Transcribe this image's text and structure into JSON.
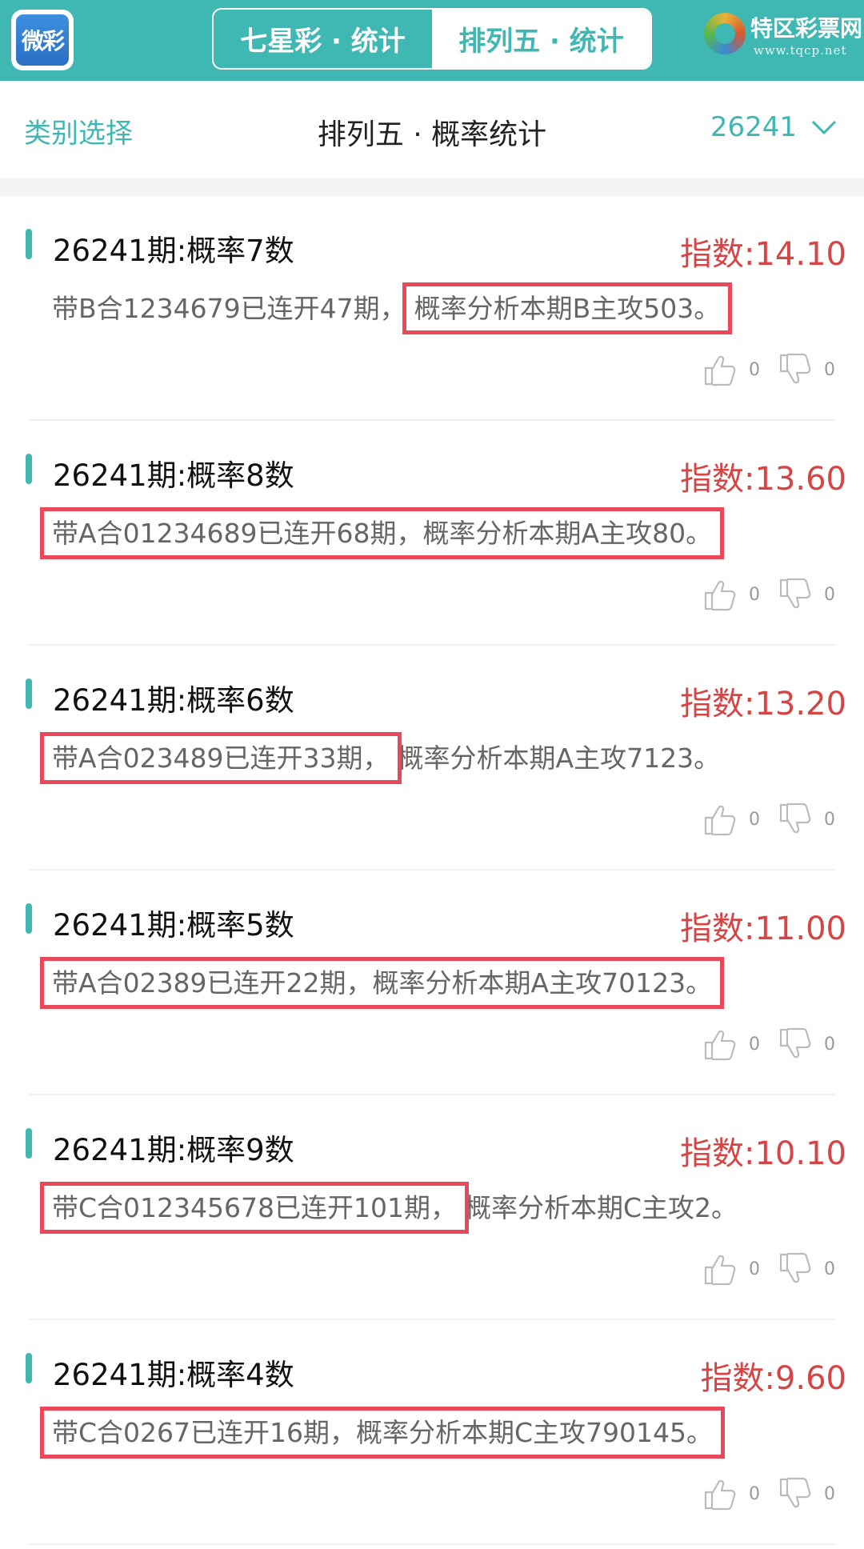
{
  "header": {
    "logo_text": "微彩",
    "tabs": [
      {
        "label": "七星彩 · 统计",
        "active": false
      },
      {
        "label": "排列五 · 统计",
        "active": true
      }
    ],
    "brand_name": "特区彩票网",
    "brand_url": "www.tqcp.net"
  },
  "subheader": {
    "category_label": "类别选择",
    "title": "排列五 · 概率统计",
    "issue": "26241"
  },
  "colors": {
    "primary": "#3fb8b4",
    "index_red": "#d54545",
    "highlight_box": "#e8485a"
  },
  "cards": [
    {
      "title": "26241期:概率7数",
      "index": "指数:14.10",
      "desc_plain": "带B合1234679已连开47期，",
      "desc_highlight": "概率分析本期B主攻503。",
      "highlight": "right",
      "likes": "0",
      "dislikes": "0"
    },
    {
      "title": "26241期:概率8数",
      "index": "指数:13.60",
      "desc_highlight": "带A合01234689已连开68期，概率分析本期A主攻80。",
      "highlight": "full",
      "likes": "0",
      "dislikes": "0"
    },
    {
      "title": "26241期:概率6数",
      "index": "指数:13.20",
      "desc_highlight": "带A合023489已连开33期，",
      "desc_plain": "概率分析本期A主攻7123。",
      "highlight": "left",
      "likes": "0",
      "dislikes": "0"
    },
    {
      "title": "26241期:概率5数",
      "index": "指数:11.00",
      "desc_highlight": "带A合02389已连开22期，概率分析本期A主攻70123。",
      "highlight": "full",
      "likes": "0",
      "dislikes": "0"
    },
    {
      "title": "26241期:概率9数",
      "index": "指数:10.10",
      "desc_highlight": "带C合012345678已连开101期，",
      "desc_plain": "概率分析本期C主攻2。",
      "highlight": "left",
      "likes": "0",
      "dislikes": "0"
    },
    {
      "title": "26241期:概率4数",
      "index": "指数:9.60",
      "desc_highlight": "带C合0267已连开16期，概率分析本期C主攻790145。",
      "highlight": "full",
      "likes": "0",
      "dislikes": "0"
    }
  ]
}
